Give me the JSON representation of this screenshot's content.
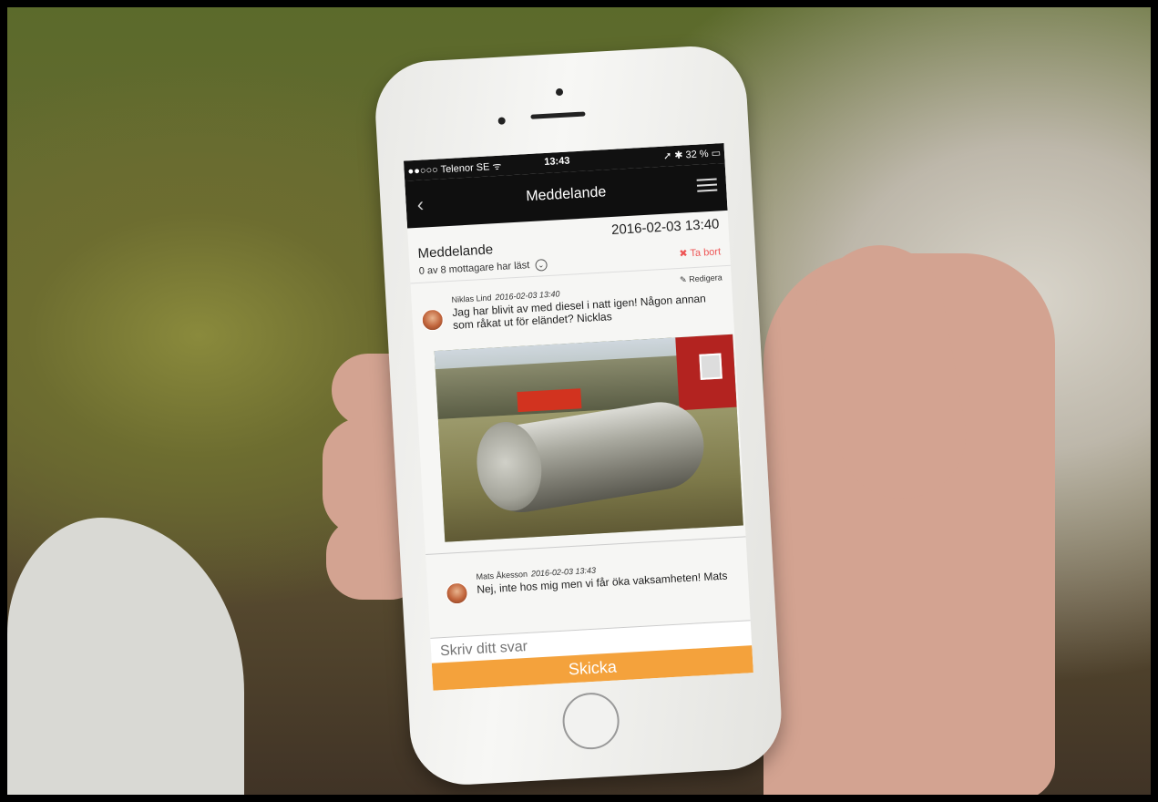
{
  "status_bar": {
    "carrier": "●●○○○ Telenor SE ᯤ",
    "time": "13:43",
    "battery": "➚ ✱ 32 % ▭"
  },
  "nav": {
    "title": "Meddelande"
  },
  "header": {
    "title": "Meddelande",
    "date": "2016-02-03 13:40",
    "read_status": "0 av 8 mottagare har läst",
    "delete_label": "Ta bort"
  },
  "messages": [
    {
      "author": "Niklas Lind",
      "time": "2016-02-03 13:40",
      "text": "Jag har blivit av med diesel i natt igen! Någon annan som råkat ut för eländet? Nicklas",
      "edit_label": "Redigera"
    },
    {
      "author": "Mats Åkesson",
      "time": "2016-02-03 13:43",
      "text": "Nej, inte hos mig men vi får öka vaksamheten! Mats"
    }
  ],
  "reply": {
    "placeholder": "Skriv ditt svar",
    "send_label": "Skicka"
  },
  "colors": {
    "accent": "#f4a23c",
    "delete": "#e55555",
    "nav_bg": "#0f0f0f"
  },
  "icons": [
    "back-icon",
    "menu-icon",
    "chevron-down-circle-icon",
    "delete-x-icon",
    "edit-icon",
    "camera-icon",
    "home-button-icon"
  ]
}
